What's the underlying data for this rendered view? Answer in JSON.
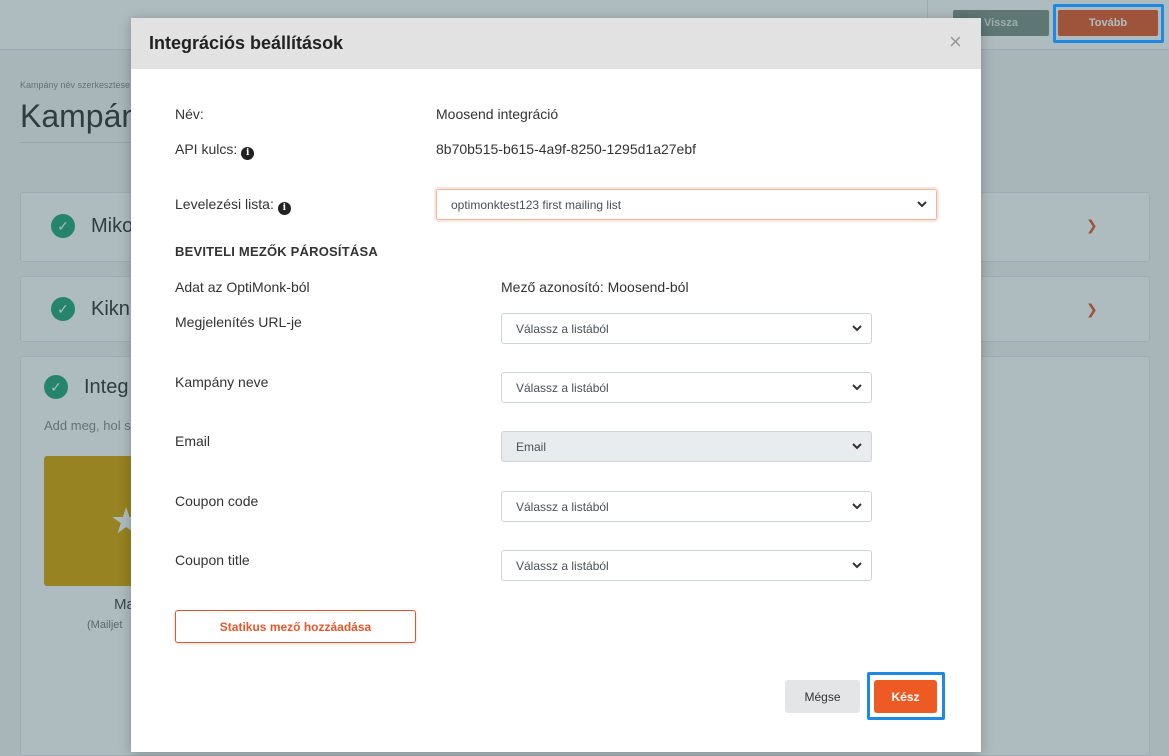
{
  "header": {
    "back_label": "Vissza",
    "next_label": "Tovább"
  },
  "background": {
    "breadcrumb": "Kampány név szerkesztése",
    "title": "Kampány",
    "card1_title": "Mikor",
    "card2_title": "Kikn",
    "card3_title": "Integ",
    "card3_subtitle": "Add meg, hol s",
    "tile_name": "Ma",
    "tile_sub": "(Mailjet"
  },
  "modal": {
    "title": "Integrációs beállítások",
    "close_glyph": "×",
    "name_label": "Név:",
    "name_value": "Moosend integráció",
    "api_label": "API kulcs:",
    "api_value": "8b70b515-b615-4a9f-8250-1295d1a27ebf",
    "list_label": "Levelezési lista:",
    "list_selected": "optimonktest123 first mailing list",
    "section_title": "BEVITELI MEZŐK PÁROSÍTÁSA",
    "col_left": "Adat az OptiMonk-ból",
    "col_right": "Mező azonosító: Moosend-ból",
    "mappings": [
      {
        "label": "Megjelenítés URL-je",
        "selected": "Válassz a listából",
        "disabled": false
      },
      {
        "label": "Kampány neve",
        "selected": "Válassz a listából",
        "disabled": false
      },
      {
        "label": "Email",
        "selected": "Email",
        "disabled": true
      },
      {
        "label": "Coupon code",
        "selected": "Válassz a listából",
        "disabled": false
      },
      {
        "label": "Coupon title",
        "selected": "Válassz a listából",
        "disabled": false
      }
    ],
    "add_static_label": "Statikus mező hozzáadása",
    "cancel_label": "Mégse",
    "done_label": "Kész"
  },
  "colors": {
    "accent": "#ee5a24",
    "highlight": "#1e88e5",
    "success": "#1fa67a"
  }
}
